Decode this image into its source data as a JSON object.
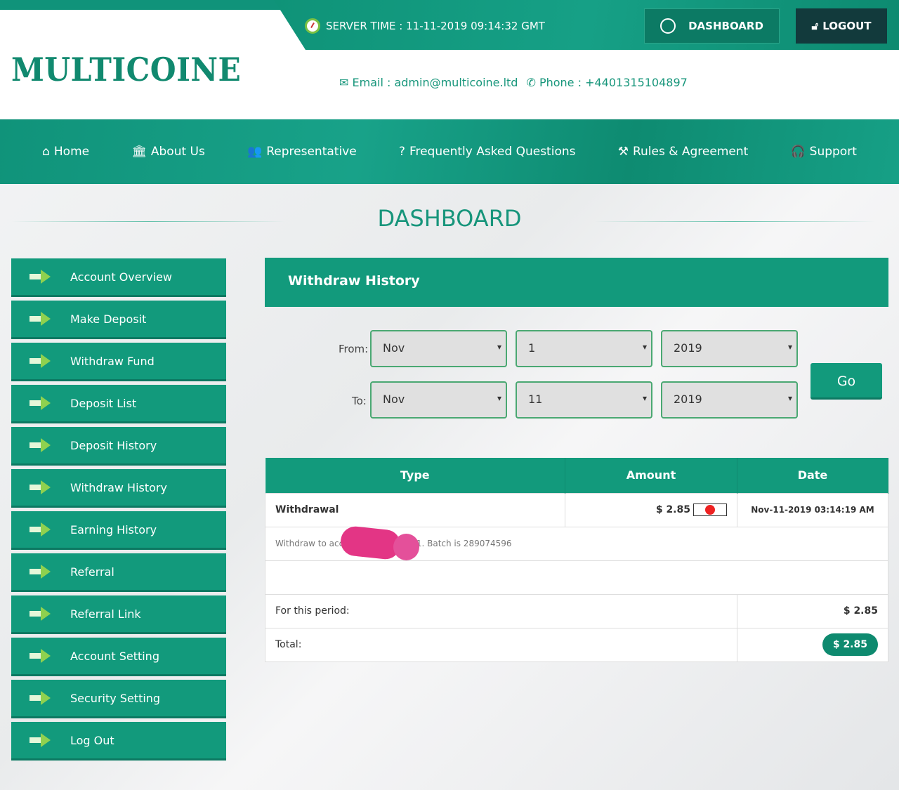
{
  "header": {
    "logo": "MULTICOINE",
    "server_time": "SERVER TIME : 11-11-2019 09:14:32 GMT",
    "dashboard_btn": "DASHBOARD",
    "logout_btn": "LOGOUT",
    "email": "Email : admin@multicoine.ltd",
    "phone": "Phone : +4401315104897"
  },
  "nav": [
    {
      "icon": "home-icon",
      "glyph": "⌂",
      "label": "Home"
    },
    {
      "icon": "bank-icon",
      "glyph": "🏛",
      "label": "About Us"
    },
    {
      "icon": "users-icon",
      "glyph": "👥",
      "label": "Representative"
    },
    {
      "icon": "question-icon",
      "glyph": "?",
      "label": "Frequently Asked Questions"
    },
    {
      "icon": "gavel-icon",
      "glyph": "⚒",
      "label": "Rules & Agreement"
    },
    {
      "icon": "headphones-icon",
      "glyph": "🎧",
      "label": "Support"
    }
  ],
  "page_title": "DASHBOARD",
  "sidebar": [
    "Account Overview",
    "Make Deposit",
    "Withdraw Fund",
    "Deposit List",
    "Deposit History",
    "Withdraw History",
    "Earning History",
    "Referral",
    "Referral Link",
    "Account Setting",
    "Security Setting",
    "Log Out"
  ],
  "panel": {
    "title": "Withdraw History",
    "from_label": "From:",
    "to_label": "To:",
    "from": {
      "month": "Nov",
      "day": "1",
      "year": "2019"
    },
    "to": {
      "month": "Nov",
      "day": "11",
      "year": "2019"
    },
    "go": "Go"
  },
  "table": {
    "headers": [
      "Type",
      "Amount",
      "Date"
    ],
    "row": {
      "type": "Withdrawal",
      "amount": "$ 2.85",
      "date": "Nov-11-2019 03:14:19 AM",
      "note_start": "Withdraw to acc",
      "note_end": "41. Batch is 289074596"
    },
    "period_label": "For this period:",
    "period_value": "$ 2.85",
    "total_label": "Total:",
    "total_value": "$ 2.85"
  },
  "colors": {
    "primary": "#129a7c",
    "dark": "#123a3c"
  }
}
